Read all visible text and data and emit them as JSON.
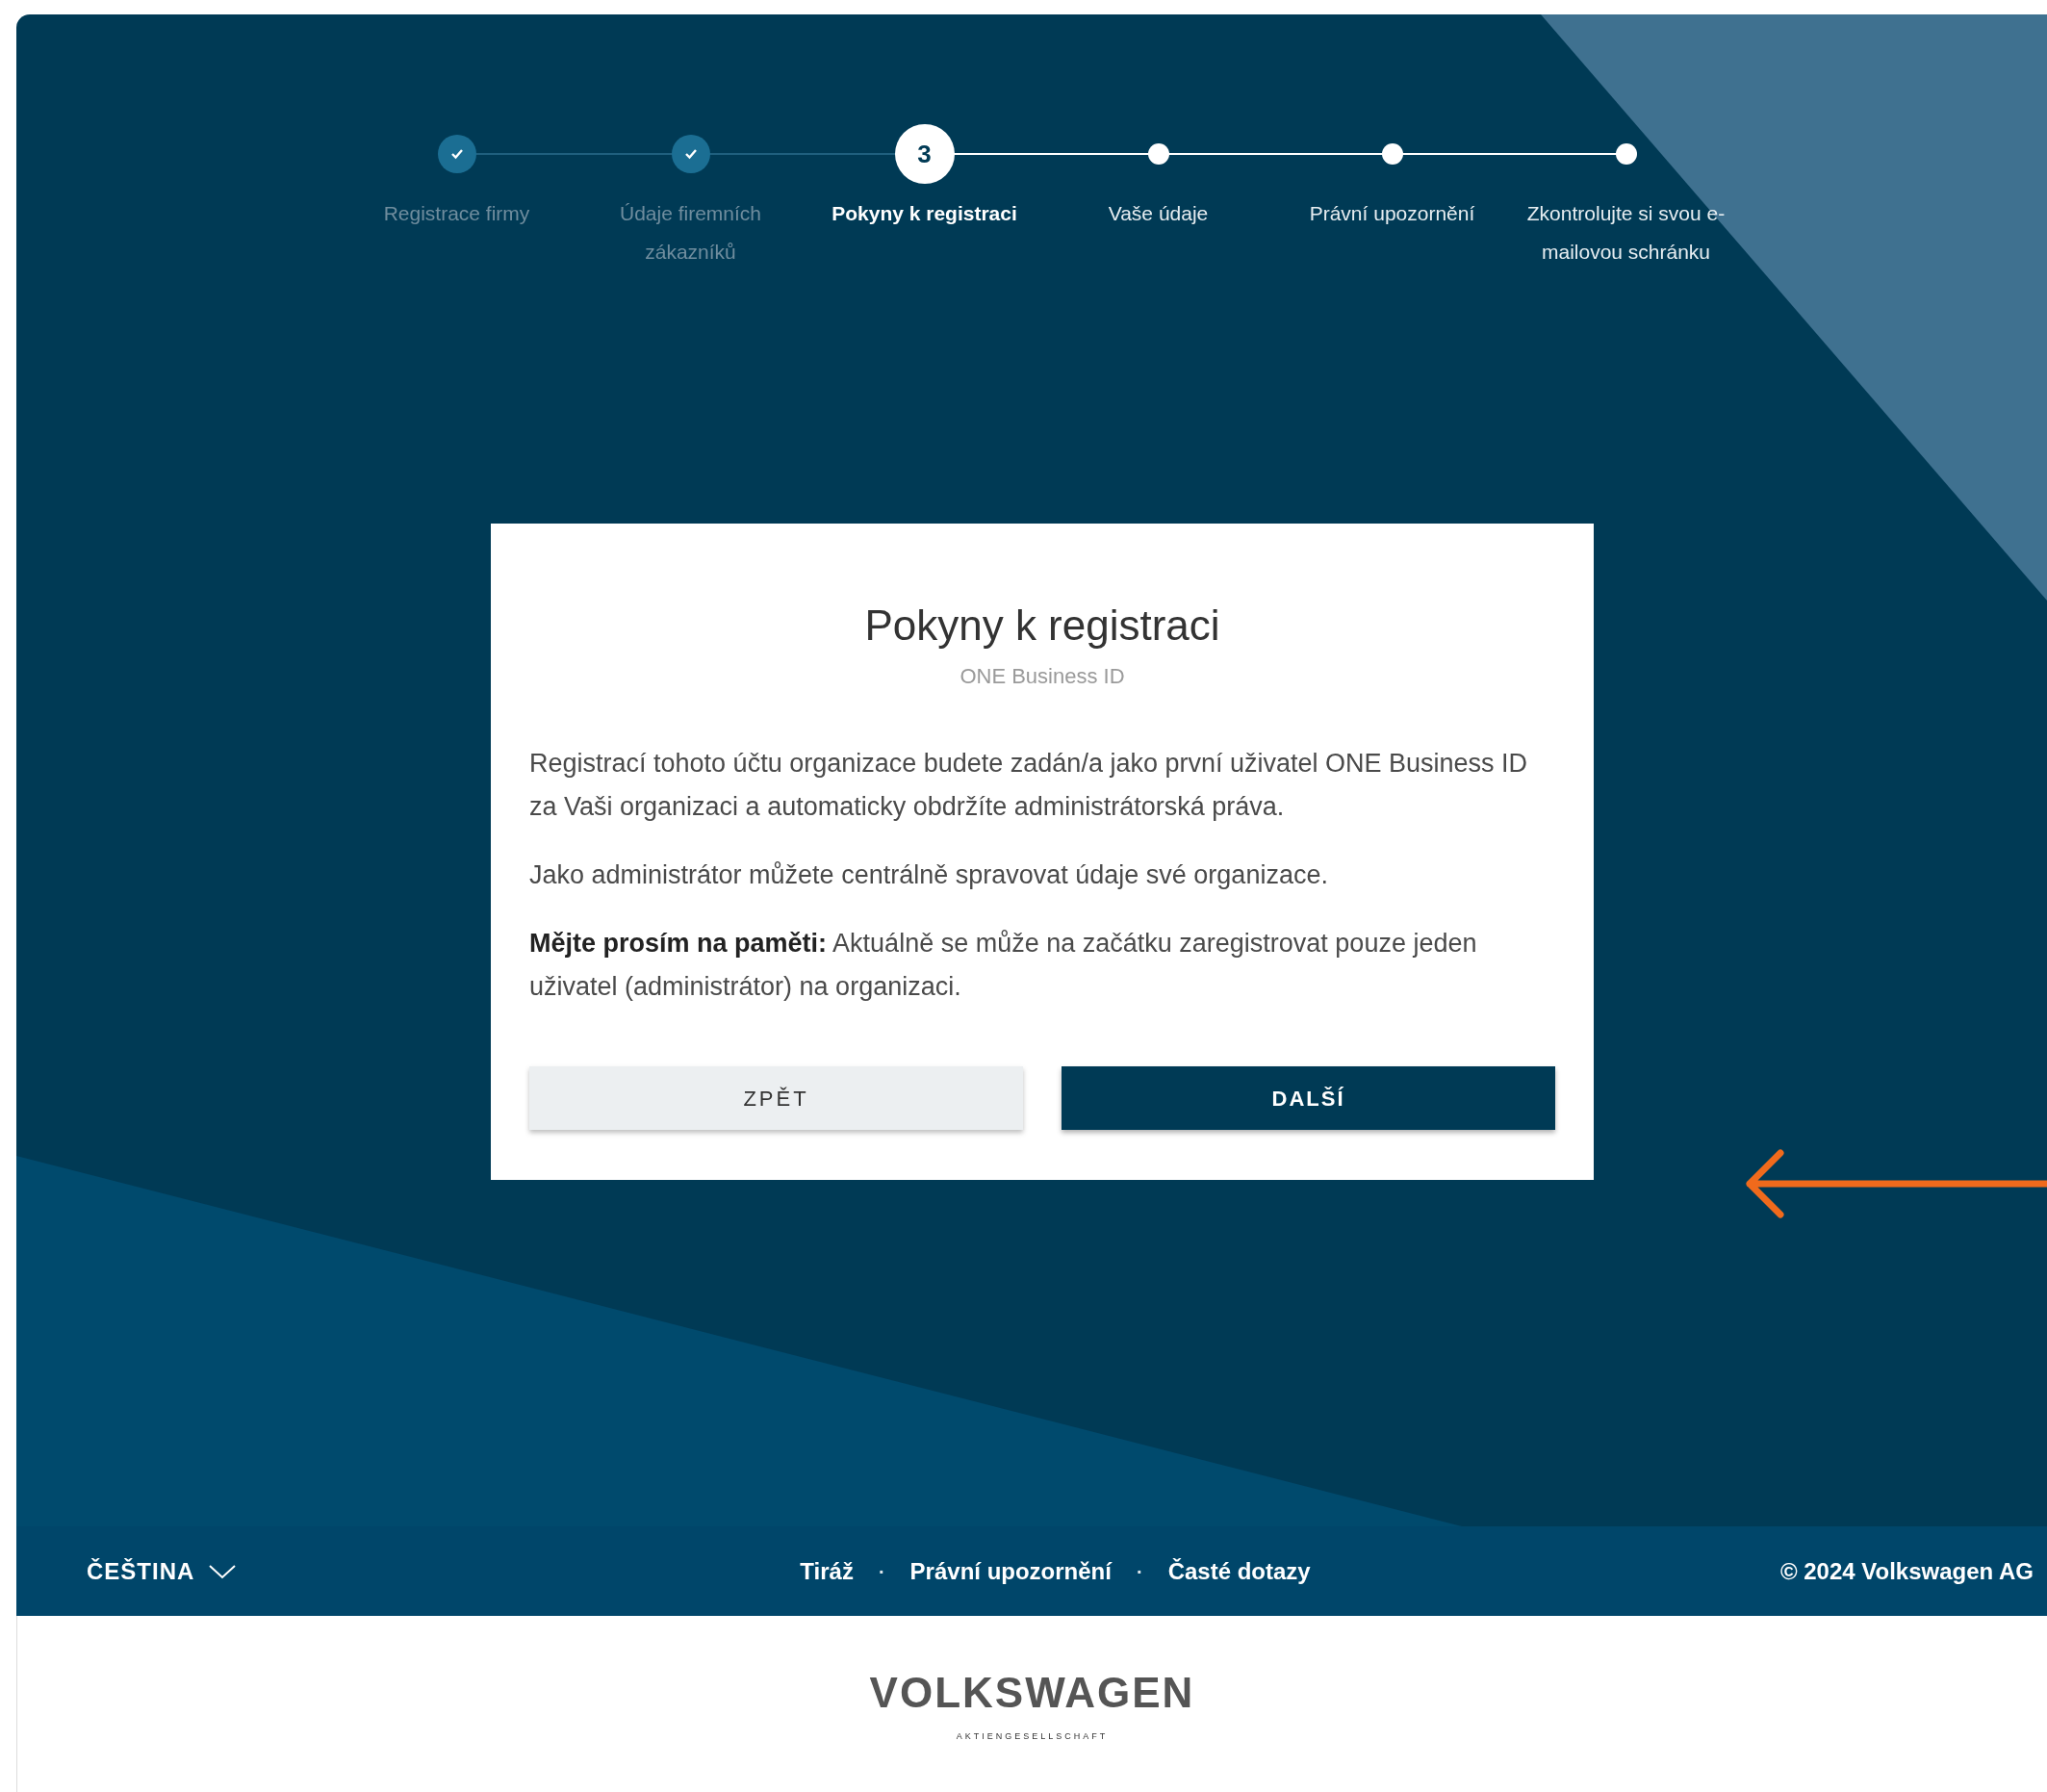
{
  "stepper": [
    {
      "label": "Registrace firmy",
      "kind": "done"
    },
    {
      "label": "Údaje firemních zákazníků",
      "kind": "done"
    },
    {
      "label": "Pokyny k registraci",
      "kind": "current",
      "number": "3"
    },
    {
      "label": "Vaše údaje",
      "kind": "upcoming"
    },
    {
      "label": "Právní upozornění",
      "kind": "upcoming"
    },
    {
      "label": "Zkontrolujte si svou e-mailovou schránku",
      "kind": "upcoming"
    }
  ],
  "card": {
    "title": "Pokyny k registraci",
    "subtitle": "ONE Business ID",
    "paragraphs": [
      "Registrací tohoto účtu organizace budete zadán/a jako první uživatel ONE Business ID za Vaši organizaci a automaticky obdržíte administrátorská práva.",
      "Jako administrátor můžete centrálně spravovat údaje své organizace.",
      "**Mějte prosím na paměti:** Aktuálně se může na začátku zaregistrovat pouze jeden uživatel (administrátor) na organizaci."
    ],
    "buttons": [
      {
        "label": "ZPĚT",
        "kind": "secondary"
      },
      {
        "label": "DALŠÍ",
        "kind": "primary"
      }
    ]
  },
  "footer": {
    "language": "ČEŠTINA",
    "nav": [
      {
        "kind": "link",
        "text": "Tiráž"
      },
      {
        "kind": "dot",
        "text": "·"
      },
      {
        "kind": "link",
        "text": "Právní upozornění"
      },
      {
        "kind": "dot",
        "text": "·"
      },
      {
        "kind": "link",
        "text": "Časté dotazy"
      }
    ],
    "copyright": "© 2024 Volkswagen AG"
  },
  "logo": {
    "name": "VOLKSWAGEN",
    "tagline": "AKTIENGESELLSCHAFT"
  }
}
